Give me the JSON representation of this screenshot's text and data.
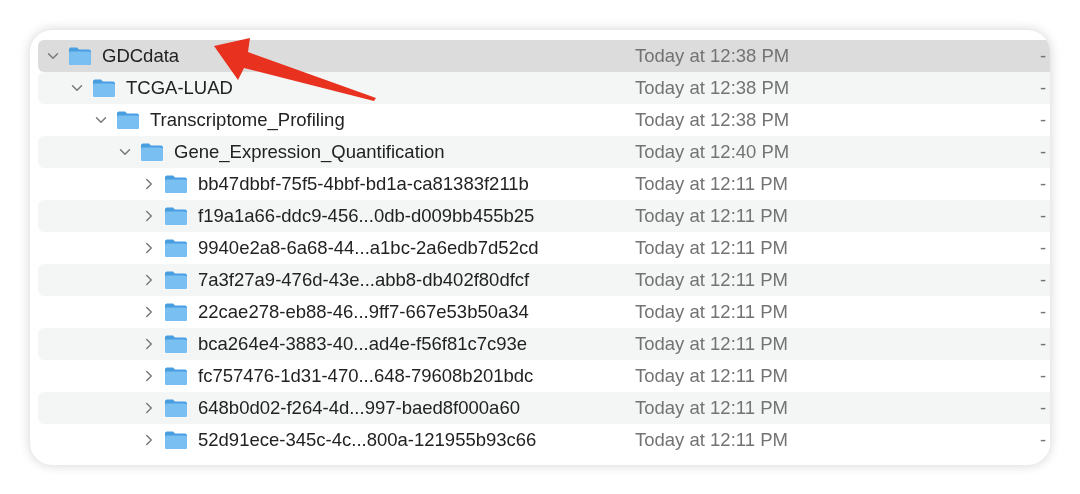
{
  "items": [
    {
      "name": "GDCdata",
      "modified": "Today at 12:38 PM",
      "size": "-",
      "expanded": true,
      "selected": true,
      "children": [
        {
          "name": "TCGA-LUAD",
          "modified": "Today at 12:38 PM",
          "size": "-",
          "expanded": true,
          "selected": false,
          "children": [
            {
              "name": "Transcriptome_Profiling",
              "modified": "Today at 12:38 PM",
              "size": "-",
              "expanded": true,
              "selected": false,
              "children": [
                {
                  "name": "Gene_Expression_Quantification",
                  "modified": "Today at 12:40 PM",
                  "size": "-",
                  "expanded": true,
                  "selected": false,
                  "children": [
                    {
                      "name": "bb47dbbf-75f5-4bbf-bd1a-ca81383f211b",
                      "modified": "Today at 12:11 PM",
                      "size": "-",
                      "expanded": false,
                      "selected": false
                    },
                    {
                      "name": "f19a1a66-ddc9-456...0db-d009bb455b25",
                      "modified": "Today at 12:11 PM",
                      "size": "-",
                      "expanded": false,
                      "selected": false
                    },
                    {
                      "name": "9940e2a8-6a68-44...a1bc-2a6edb7d52cd",
                      "modified": "Today at 12:11 PM",
                      "size": "-",
                      "expanded": false,
                      "selected": false
                    },
                    {
                      "name": "7a3f27a9-476d-43e...abb8-db402f80dfcf",
                      "modified": "Today at 12:11 PM",
                      "size": "-",
                      "expanded": false,
                      "selected": false
                    },
                    {
                      "name": "22cae278-eb88-46...9ff7-667e53b50a34",
                      "modified": "Today at 12:11 PM",
                      "size": "-",
                      "expanded": false,
                      "selected": false
                    },
                    {
                      "name": "bca264e4-3883-40...ad4e-f56f81c7c93e",
                      "modified": "Today at 12:11 PM",
                      "size": "-",
                      "expanded": false,
                      "selected": false
                    },
                    {
                      "name": "fc757476-1d31-470...648-79608b201bdc",
                      "modified": "Today at 12:11 PM",
                      "size": "-",
                      "expanded": false,
                      "selected": false
                    },
                    {
                      "name": "648b0d02-f264-4d...997-baed8f000a60",
                      "modified": "Today at 12:11 PM",
                      "size": "-",
                      "expanded": false,
                      "selected": false
                    },
                    {
                      "name": "52d91ece-345c-4c...800a-121955b93c66",
                      "modified": "Today at 12:11 PM",
                      "size": "-",
                      "expanded": false,
                      "selected": false
                    }
                  ]
                }
              ]
            }
          ]
        }
      ]
    }
  ]
}
